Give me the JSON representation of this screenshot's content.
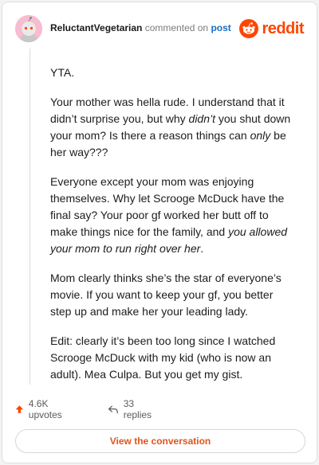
{
  "header": {
    "username": "ReluctantVegetarian",
    "commented_on": "commented on",
    "post_link": "post",
    "brand_name": "reddit"
  },
  "comment": {
    "paragraphs": [
      [
        {
          "text": "YTA.",
          "italic": false
        }
      ],
      [
        {
          "text": "Your mother was hella rude. I understand that it didn’t surprise you, but why ",
          "italic": false
        },
        {
          "text": "didn’t",
          "italic": true
        },
        {
          "text": " you shut down your mom? Is there a reason things can ",
          "italic": false
        },
        {
          "text": "only",
          "italic": true
        },
        {
          "text": " be her way???",
          "italic": false
        }
      ],
      [
        {
          "text": "Everyone except your mom was enjoying themselves. Why let Scrooge McDuck have the final say? Your poor gf worked her butt off to make things nice for the family, and ",
          "italic": false
        },
        {
          "text": "you allowed your mom to run right over her",
          "italic": true
        },
        {
          "text": ".",
          "italic": false
        }
      ],
      [
        {
          "text": "Mom clearly thinks she’s the star of everyone’s movie. If you want to keep your gf, you better step up and make her your leading lady.",
          "italic": false
        }
      ],
      [
        {
          "text": "Edit: clearly it’s been too long since I watched Scrooge McDuck with my kid (who is now an adult). Mea Culpa. But you get my gist.",
          "italic": false
        }
      ]
    ]
  },
  "actions": {
    "upvotes": "4.6K upvotes",
    "replies": "33 replies",
    "view_button": "View the conversation"
  },
  "colors": {
    "brand": "#ff4500",
    "link": "#1a6ec3",
    "avatar_bg": "#f7bcd0"
  }
}
